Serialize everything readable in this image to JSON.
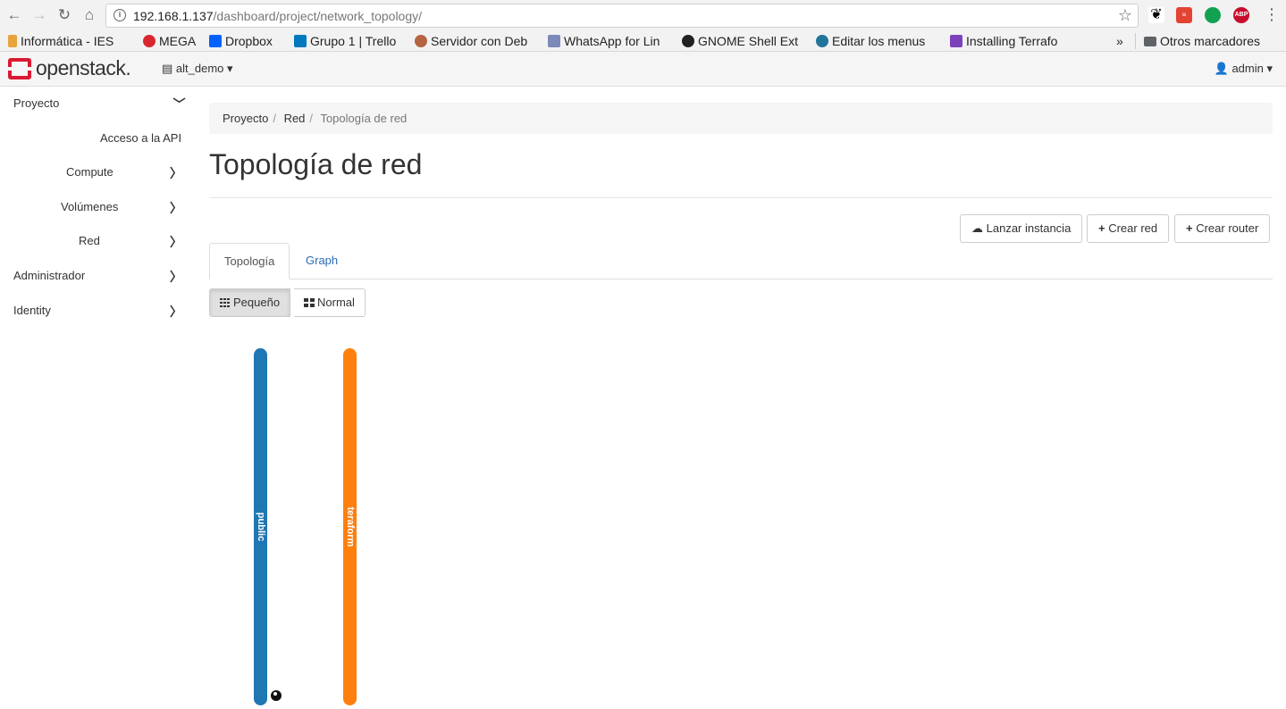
{
  "browser": {
    "url_host": "192.168.1.137",
    "url_path": "/dashboard/project/network_topology/",
    "bookmarks": [
      "Informática - IES",
      "MEGA",
      "Dropbox",
      "Grupo 1 | Trello",
      "Servidor con Deb",
      "WhatsApp for Lin",
      "GNOME Shell Ext",
      "Editar los menus",
      "Installing Terrafo"
    ],
    "bookmarks_overflow": "»",
    "other_bookmarks": "Otros marcadores"
  },
  "header": {
    "logo": "openstack.",
    "project": "alt_demo",
    "user": "admin"
  },
  "sidebar": {
    "items": [
      {
        "label": "Proyecto"
      },
      {
        "label": "Acceso a la API"
      },
      {
        "label": "Compute"
      },
      {
        "label": "Volúmenes"
      },
      {
        "label": "Red"
      },
      {
        "label": "Administrador"
      },
      {
        "label": "Identity"
      }
    ]
  },
  "breadcrumb": {
    "items": [
      "Proyecto",
      "Red",
      "Topología de red"
    ]
  },
  "page": {
    "title": "Topología de red",
    "actions": {
      "launch": "Lanzar instancia",
      "create_net": "Crear red",
      "create_router": "Crear router"
    },
    "tabs": [
      "Topología",
      "Graph"
    ],
    "sizes": [
      "Pequeño",
      "Normal"
    ]
  },
  "topology": {
    "networks": [
      {
        "name": "public",
        "color": "#1f77b4"
      },
      {
        "name": "teraform",
        "color": "#ff7f0e"
      }
    ]
  }
}
